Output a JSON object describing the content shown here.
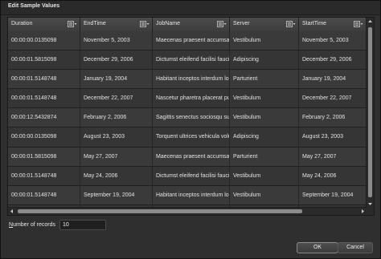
{
  "dialog": {
    "title": "Edit Sample Values"
  },
  "grid": {
    "columns": [
      {
        "label": "Duration"
      },
      {
        "label": "EndTime"
      },
      {
        "label": "JobName"
      },
      {
        "label": "Server"
      },
      {
        "label": "StartTime"
      }
    ],
    "rows": [
      [
        "00:00:00.0135098",
        "November 5, 2003",
        "Maecenas praesent accumsan bibendum",
        "Vestibulum",
        "November 5, 2003"
      ],
      [
        "00:00:01.5815098",
        "December 29, 2006",
        "Dictumst eleifend facilisi faucibus",
        "Adipiscing",
        "December 29, 2006"
      ],
      [
        "00:00:01.5148748",
        "January 19, 2004",
        "Habitant inceptos interdum lobortis",
        "Parturient",
        "January 19, 2004"
      ],
      [
        "00:00:01.5148748",
        "December 22, 2007",
        "Nascetur pharetra placerat pulvinar",
        "Vestibulum",
        "December 22, 2007"
      ],
      [
        "00:00:12.5432874",
        "February 2, 2006",
        "Sagittis senectus sociosqu suscipit",
        "Vestibulum",
        "February 2, 2006"
      ],
      [
        "00:00:00.0135098",
        "August 23, 2003",
        "Torquent ultrices vehicula volutpat",
        "Adipiscing",
        "August 23, 2003"
      ],
      [
        "00:00:01.5815098",
        "May 27, 2007",
        "Maecenas praesent accumsan bibendum",
        "Parturient",
        "May 27, 2007"
      ],
      [
        "00:00:01.5148748",
        "May 24, 2006",
        "Dictumst eleifend facilisi faucibus",
        "Vestibulum",
        "May 24, 2006"
      ],
      [
        "00:00:01.5148748",
        "September 19, 2004",
        "Habitant inceptos interdum lobortis",
        "Vestibulum",
        "September 19, 2004"
      ],
      [
        "",
        "",
        "",
        "",
        ""
      ]
    ]
  },
  "records": {
    "label": "Number of records",
    "value": "10"
  },
  "buttons": {
    "ok": "OK",
    "cancel": "Cancel"
  }
}
